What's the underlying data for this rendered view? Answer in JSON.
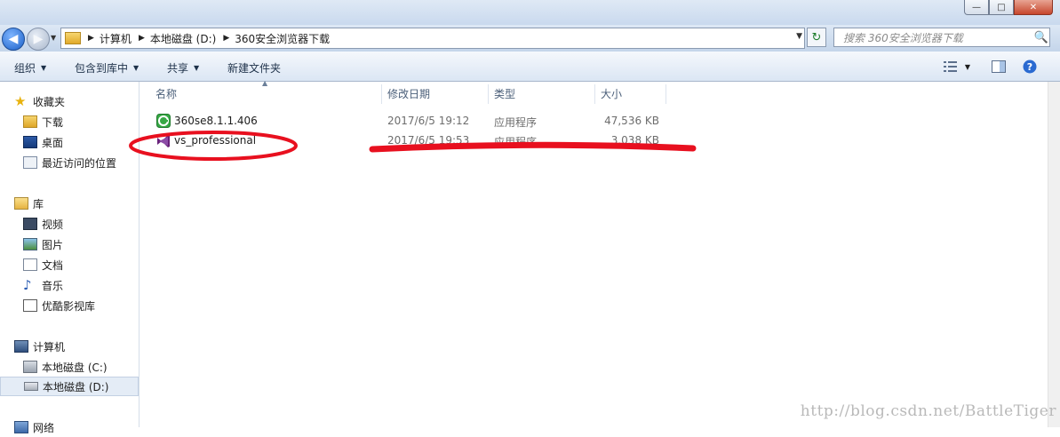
{
  "address": {
    "crumbs": [
      "计算机",
      "本地磁盘 (D:)",
      "360安全浏览器下载"
    ]
  },
  "search": {
    "placeholder": "搜索 360安全浏览器下载"
  },
  "toolbar": {
    "organize": "组织",
    "include_in_library": "包含到库中",
    "share": "共享",
    "new_folder": "新建文件夹"
  },
  "sidebar": {
    "favorites": {
      "label": "收藏夹",
      "items": [
        "下载",
        "桌面",
        "最近访问的位置"
      ]
    },
    "libraries": {
      "label": "库",
      "items": [
        "视频",
        "图片",
        "文档",
        "音乐",
        "优酷影视库"
      ]
    },
    "computer": {
      "label": "计算机",
      "items": [
        "本地磁盘 (C:)",
        "本地磁盘 (D:)"
      ]
    },
    "network": {
      "label": "网络"
    }
  },
  "columns": {
    "name": "名称",
    "modified": "修改日期",
    "type": "类型",
    "size": "大小"
  },
  "files": [
    {
      "name": "360se8.1.1.406",
      "modified": "2017/6/5 19:12",
      "type": "应用程序",
      "size": "47,536 KB"
    },
    {
      "name": "vs_professional",
      "modified": "2017/6/5 19:53",
      "type": "应用程序",
      "size": "3,038 KB"
    }
  ],
  "watermark": "http://blog.csdn.net/BattleTiger",
  "colors": {
    "annotation_red": "#e8101f",
    "selection": "#e4ecf6"
  }
}
